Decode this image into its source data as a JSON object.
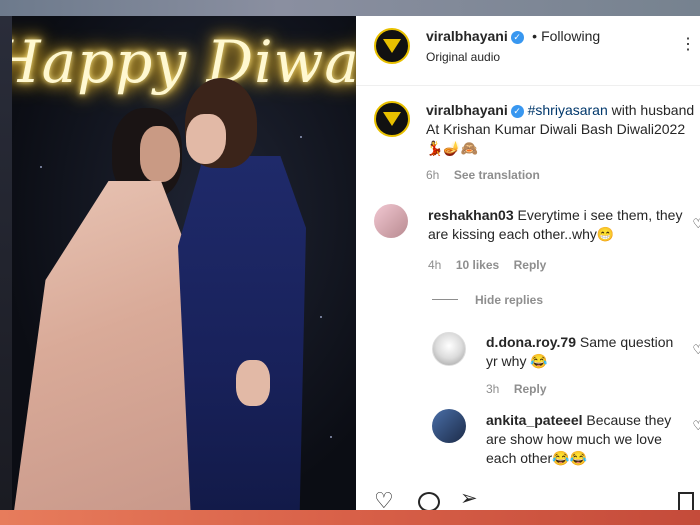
{
  "post": {
    "header": {
      "username": "viralbhayani",
      "dot": "•",
      "follow_state": "Following",
      "audio": "Original audio",
      "more": "⋮"
    },
    "caption": {
      "username": "viralbhayani",
      "hashtag": "#shriyasaran",
      "text_part1": " with husband At Krishan Kumar Diwali Bash Diwali2022",
      "emojis": "💃🪔🙈",
      "time": "6h",
      "see_translation": "See translation"
    },
    "comments": [
      {
        "username": "reshakhan03",
        "text": "Everytime i see them, they are kissing each other..why😁",
        "time": "4h",
        "likes": "10 likes",
        "reply": "Reply"
      }
    ],
    "hide_replies": "Hide replies",
    "replies": [
      {
        "username": "d.dona.roy.79",
        "text": "Same question yr why 😂",
        "time": "3h",
        "reply": "Reply"
      },
      {
        "username": "ankita_pateeel",
        "text": "Because they are show how much we love each other😂😂"
      }
    ]
  },
  "photo": {
    "neon_text": "Happy Diwali"
  },
  "colors": {
    "brand_yellow": "#e8c000",
    "verified_blue": "#3897f0",
    "link_blue": "#00376b",
    "muted": "#8e8e8e"
  },
  "icons": {
    "like": "heart-icon",
    "comment": "comment-icon",
    "share": "share-icon",
    "more": "more-options-icon"
  }
}
